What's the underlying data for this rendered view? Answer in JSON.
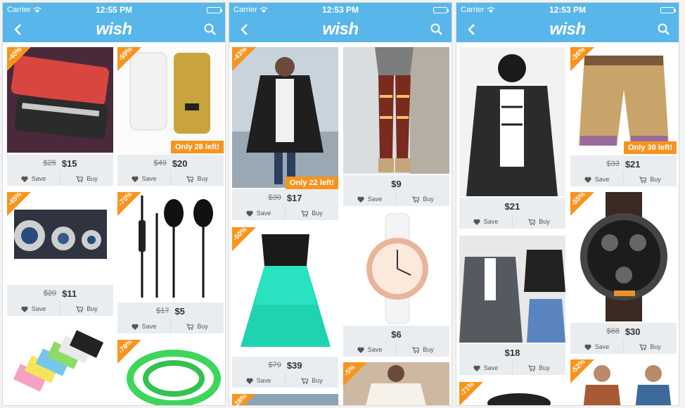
{
  "status": {
    "carrier": "Carrier"
  },
  "nav": {
    "brand": "wish"
  },
  "labels": {
    "save": "Save",
    "buy": "Buy"
  },
  "colors": {
    "primary": "#58b6ea",
    "discount": "#f7941d",
    "pricebar": "#e9edf0"
  },
  "screens": [
    {
      "time": "12:55 PM",
      "products": [
        {
          "discount": "-40%",
          "old": "$25",
          "price": "$15",
          "left": ""
        },
        {
          "discount": "-59%",
          "old": "$49",
          "price": "$20",
          "left": "Only 28 left!"
        },
        {
          "discount": "-45%",
          "old": "$20",
          "price": "$11",
          "left": ""
        },
        {
          "discount": "-70%",
          "old": "$17",
          "price": "$5",
          "left": ""
        },
        {
          "discount": "",
          "old": "",
          "price": "",
          "left": ""
        },
        {
          "discount": "-78%",
          "old": "",
          "price": "",
          "left": ""
        }
      ]
    },
    {
      "time": "12:53 PM",
      "products": [
        {
          "discount": "-43%",
          "old": "$30",
          "price": "$17",
          "left": "Only 22 left!"
        },
        {
          "discount": "",
          "old": "",
          "price": "$9",
          "left": ""
        },
        {
          "discount": "-50%",
          "old": "$79",
          "price": "$39",
          "left": ""
        },
        {
          "discount": "",
          "old": "",
          "price": "$6",
          "left": ""
        },
        {
          "discount": "-5%",
          "old": "",
          "price": "",
          "left": ""
        },
        {
          "discount": "-28%",
          "old": "",
          "price": "",
          "left": ""
        }
      ]
    },
    {
      "time": "12:53 PM",
      "products": [
        {
          "discount": "",
          "old": "",
          "price": "$21",
          "left": ""
        },
        {
          "discount": "-36%",
          "old": "$33",
          "price": "$21",
          "left": "Only 30 left!"
        },
        {
          "discount": "",
          "old": "",
          "price": "$18",
          "left": ""
        },
        {
          "discount": "-55%",
          "old": "$68",
          "price": "$30",
          "left": ""
        },
        {
          "discount": "-71%",
          "old": "",
          "price": "",
          "left": ""
        },
        {
          "discount": "-52%",
          "old": "",
          "price": "",
          "left": ""
        }
      ]
    }
  ]
}
